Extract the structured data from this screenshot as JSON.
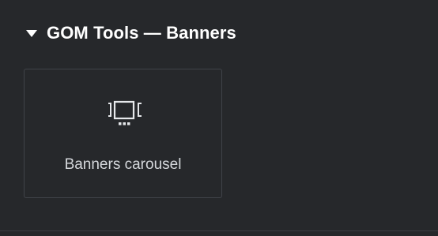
{
  "section": {
    "title": "GOM Tools — Banners",
    "icon": "caret-down-icon"
  },
  "widgets": [
    {
      "label": "Banners carousel",
      "icon": "carousel-icon"
    }
  ],
  "colors": {
    "background": "#26282b",
    "title": "#ffffff",
    "label": "#d5d8dc",
    "card_border": "#404349"
  }
}
